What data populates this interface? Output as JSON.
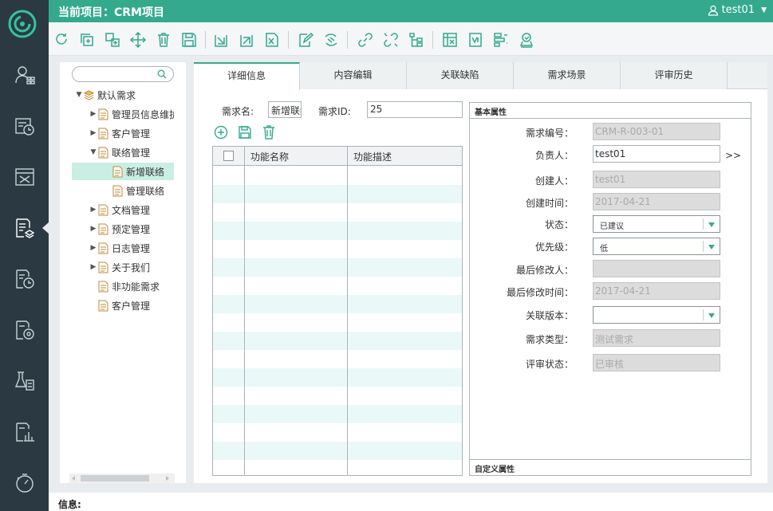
{
  "app": {
    "project_title": "当前项目：CRM项目",
    "user": "test01"
  },
  "colors": {
    "accent": "#34a98e",
    "sidebar": "#2b3a42",
    "selected_tree": "#c9eee3",
    "alt_row": "#eaf8f8"
  },
  "left_nav": {
    "icons": [
      "users-icon",
      "history-icon",
      "kanban-icon",
      "requirements-icon",
      "schedule-icon",
      "settings-report-icon",
      "test-icon",
      "stats-icon",
      "timer-icon"
    ]
  },
  "toolbar": {
    "icons": [
      "refresh-icon",
      "copy-icon",
      "clone-icon",
      "move-icon",
      "delete-icon",
      "save-icon",
      "import-icon",
      "export-icon",
      "excel-icon",
      "edit-icon",
      "link-req-icon",
      "link-icon",
      "unlink-icon",
      "tree-icon",
      "matrix-icon",
      "version-icon",
      "align-icon",
      "review-icon"
    ]
  },
  "tree": {
    "search_placeholder": "",
    "items": [
      {
        "label": "默认需求",
        "expanded": true
      },
      {
        "label": "管理员信息维护",
        "expanded": false
      },
      {
        "label": "客户管理",
        "expanded": false
      },
      {
        "label": "联络管理",
        "expanded": true
      },
      {
        "label": "新增联络",
        "selected": true
      },
      {
        "label": "管理联络"
      },
      {
        "label": "文档管理",
        "expanded": false
      },
      {
        "label": "预定管理",
        "expanded": false
      },
      {
        "label": "日志管理",
        "expanded": false
      },
      {
        "label": "关于我们",
        "expanded": false
      },
      {
        "label": "非功能需求"
      },
      {
        "label": "客户管理"
      }
    ]
  },
  "tabs": [
    {
      "label": "详细信息",
      "active": true
    },
    {
      "label": "内容编辑"
    },
    {
      "label": "关联缺陷"
    },
    {
      "label": "需求场景"
    },
    {
      "label": "评审历史"
    }
  ],
  "detail": {
    "name_label": "需求名:",
    "name_value": "新增联络",
    "id_label": "需求ID:",
    "id_value": "25",
    "grid_headers": [
      "功能名称",
      "功能描述"
    ]
  },
  "props": {
    "basic_title": "基本属性",
    "custom_title": "自定义属性",
    "more_button": ">>",
    "fields": [
      {
        "label": "需求编号：",
        "value": "CRM-R-003-01"
      },
      {
        "label": "负责人：",
        "value": "test01"
      },
      {
        "label": "创建人：",
        "value": "test01"
      },
      {
        "label": "创建时间：",
        "value": "2017-04-21"
      },
      {
        "label": "状态：",
        "value": "已建议"
      },
      {
        "label": "优先级：",
        "value": "低"
      },
      {
        "label": "最后修改人：",
        "value": ""
      },
      {
        "label": "最后修改时间：",
        "value": "2017-04-21"
      },
      {
        "label": "关联版本：",
        "value": ""
      },
      {
        "label": "需求类型：",
        "value": "测试需求"
      },
      {
        "label": "评审状态：",
        "value": "已审核"
      }
    ]
  },
  "info": {
    "label": "信息:"
  }
}
